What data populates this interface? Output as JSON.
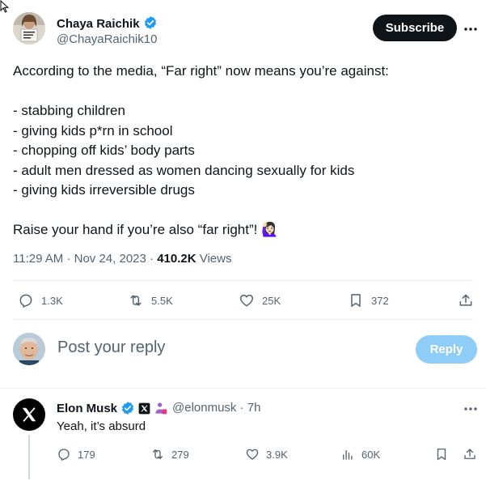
{
  "author": {
    "display_name": "Chaya Raichik",
    "handle": "@ChayaRaichik10",
    "verified_color": "#1d9bf0",
    "avatar": "profile-photo-person-holding-sign"
  },
  "header": {
    "subscribe_label": "Subscribe",
    "more_icon": "more-horizontal-icon"
  },
  "tweet": {
    "intro": "According to the media, “Far right” now means you’re against:",
    "list": [
      "- stabbing children",
      "- giving kids p*rn in school",
      "- chopping off kids’ body parts",
      "- adult men dressed as women dancing sexually for kids",
      "- giving kids irreversible drugs"
    ],
    "closing": "Raise your hand if you’re also “far right”! 🙋🏻‍♀️"
  },
  "meta": {
    "time": "11:29 AM",
    "sep": "·",
    "date": "Nov 24, 2023",
    "views_count": "410.2K",
    "views_label": "Views"
  },
  "actions": {
    "replies": "1.3K",
    "reposts": "5.5K",
    "likes": "25K",
    "bookmarks": "372"
  },
  "reply_box": {
    "placeholder": "Post your reply",
    "button_label": "Reply",
    "button_color": "#8ecdf8"
  },
  "reply": {
    "display_name": "Elon Musk",
    "handle": "@elonmusk",
    "sep": "·",
    "age": "7h",
    "text": "Yeah, it’s absurd",
    "badges": [
      "verified-icon",
      "x-affiliate-icon",
      "affiliation-badge-icon"
    ],
    "actions": {
      "replies": "179",
      "reposts": "279",
      "likes": "3.9K",
      "views": "60K"
    }
  }
}
